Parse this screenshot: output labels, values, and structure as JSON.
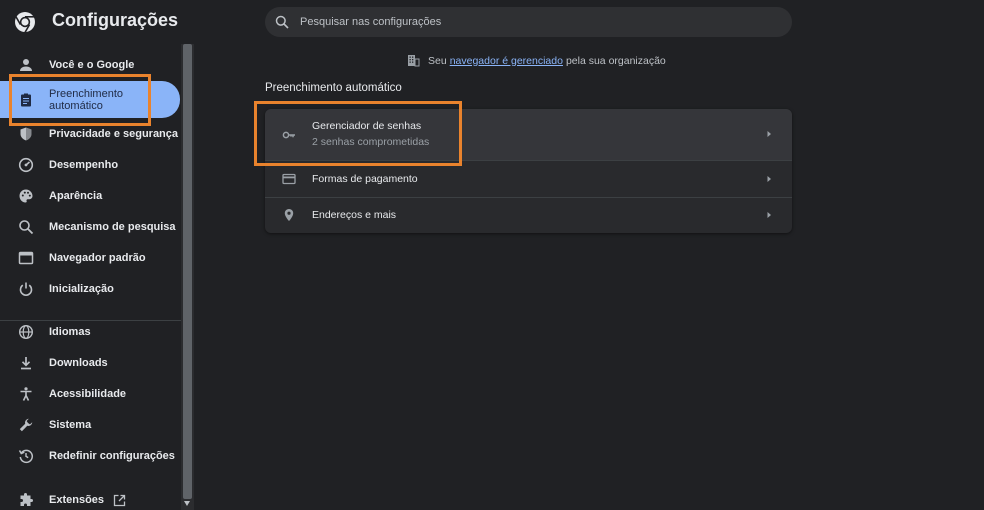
{
  "header": {
    "title": "Configurações",
    "logo_icon": "chrome-logo-icon",
    "search": {
      "placeholder": "Pesquisar nas configurações",
      "value": ""
    }
  },
  "sidebar": {
    "items": [
      {
        "label": "Você e o Google",
        "icon": "person-icon"
      },
      {
        "label": "Preenchimento automático",
        "icon": "clipboard-icon",
        "active": true
      },
      {
        "label": "Privacidade e segurança",
        "icon": "shield-icon"
      },
      {
        "label": "Desempenho",
        "icon": "speedometer-icon"
      },
      {
        "label": "Aparência",
        "icon": "palette-icon"
      },
      {
        "label": "Mecanismo de pesquisa",
        "icon": "search-icon"
      },
      {
        "label": "Navegador padrão",
        "icon": "browser-window-icon"
      },
      {
        "label": "Inicialização",
        "icon": "power-icon"
      },
      {
        "label": "Idiomas",
        "icon": "globe-icon"
      },
      {
        "label": "Downloads",
        "icon": "download-icon"
      },
      {
        "label": "Acessibilidade",
        "icon": "accessibility-icon"
      },
      {
        "label": "Sistema",
        "icon": "wrench-icon"
      },
      {
        "label": "Redefinir configurações",
        "icon": "restore-icon"
      },
      {
        "label": "Extensões",
        "icon": "puzzle-icon",
        "external": true
      }
    ]
  },
  "managed": {
    "prefix": "Seu",
    "link": "navegador é gerenciado",
    "suffix": "pela sua organização"
  },
  "autofill": {
    "title": "Preenchimento automático",
    "rows": [
      {
        "title": "Gerenciador de senhas",
        "subtitle": "2 senhas comprometidas",
        "icon": "key-icon"
      },
      {
        "title": "Formas de pagamento",
        "icon": "credit-card-icon"
      },
      {
        "title": "Endereços e mais",
        "icon": "location-pin-icon"
      }
    ]
  },
  "colors": {
    "background": "#202124",
    "accent": "#8ab4f8",
    "highlight": "#e9832d"
  }
}
